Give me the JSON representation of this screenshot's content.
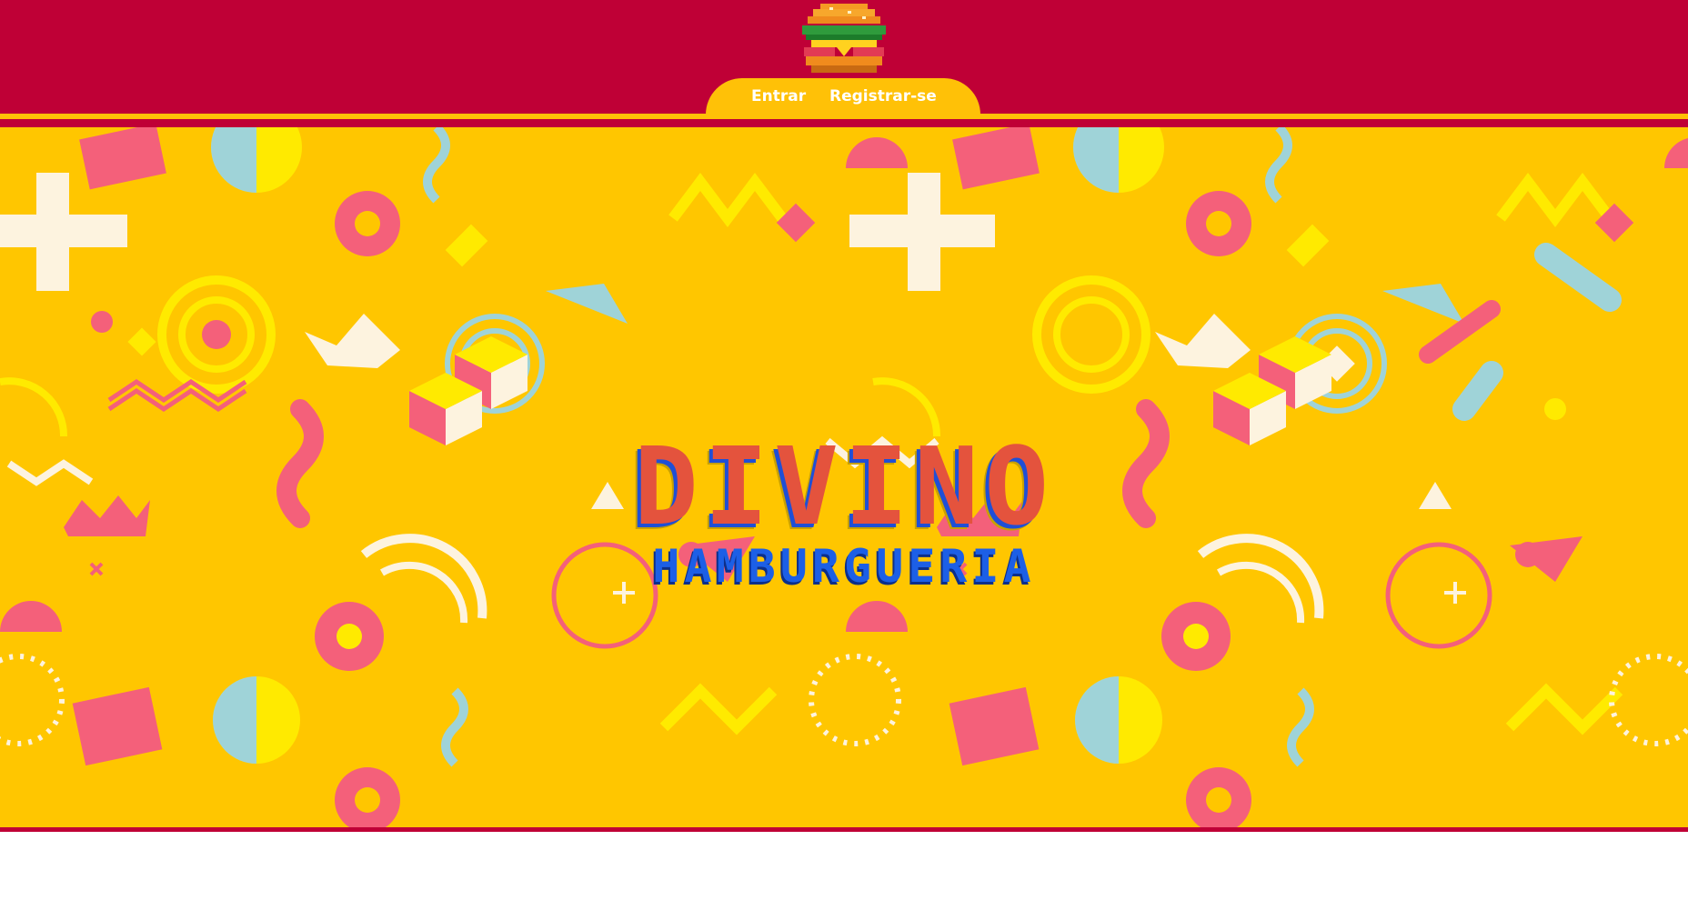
{
  "header": {
    "logo_icon": "burger-icon",
    "nav": [
      {
        "label": "Entrar"
      },
      {
        "label": "Registrar-se"
      }
    ]
  },
  "hero": {
    "title": "DIVINO",
    "subtitle": "HAMBURGUERIA"
  },
  "colors": {
    "header_bg": "#bf0036",
    "accent_yellow": "#ffc107",
    "hero_bg": "#ffc600",
    "title_red": "#e4533d",
    "subtitle_blue": "#1c5fe6",
    "pattern_pink": "#f4607a",
    "pattern_cyan": "#9fd3d8",
    "pattern_cream": "#fdf3df",
    "pattern_yellow": "#ffea00"
  }
}
